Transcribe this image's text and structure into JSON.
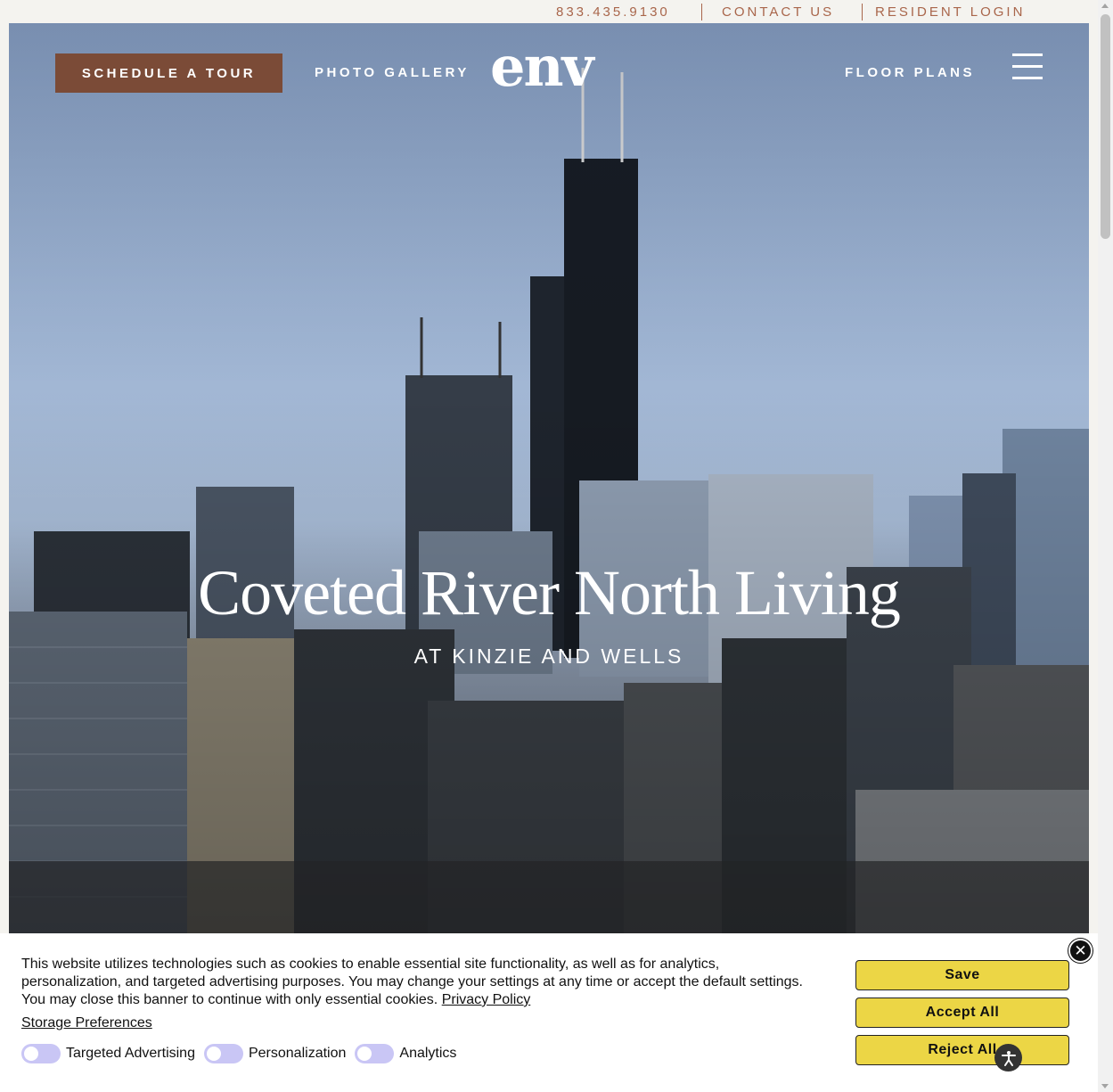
{
  "utility": {
    "phone": "833.435.9130",
    "contact": "CONTACT US",
    "resident": "RESIDENT LOGIN"
  },
  "nav": {
    "tour": "SCHEDULE A TOUR",
    "gallery": "PHOTO GALLERY",
    "logo": "env",
    "floorplans": "FLOOR PLANS"
  },
  "hero": {
    "title": "Coveted River North Living",
    "subtitle": "AT KINZIE AND WELLS"
  },
  "cookie": {
    "text": "This website utilizes technologies such as cookies to enable essential site functionality, as well as for analytics, personalization, and targeted advertising purposes. You may change your settings at any time or accept the default settings. You may close this banner to continue with only essential cookies.",
    "privacy": "Privacy Policy",
    "storage": "Storage Preferences",
    "toggles": [
      "Targeted Advertising",
      "Personalization",
      "Analytics"
    ],
    "save": "Save",
    "accept": "Accept All",
    "reject": "Reject All"
  },
  "colors": {
    "accent": "#a9664b",
    "tour_button": "#7b4b37",
    "cookie_button": "#ecd645",
    "toggle": "#c9c6f5"
  }
}
